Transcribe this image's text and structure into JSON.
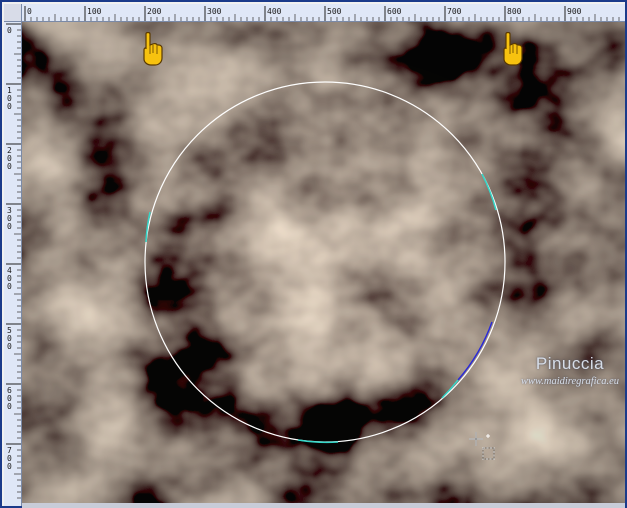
{
  "rulers": {
    "top_labels": [
      "0",
      "100",
      "200",
      "300",
      "400",
      "500",
      "600",
      "700",
      "800",
      "900"
    ],
    "left_labels": [
      "0",
      "100",
      "200",
      "300",
      "400",
      "500",
      "600",
      "700"
    ]
  },
  "canvas": {
    "selection_shape": "circle",
    "texture_colors": [
      "#a28e78",
      "#5c5448",
      "#2a2a33",
      "#b8a088"
    ]
  },
  "icons": [
    "hand-pointer-icon",
    "hand-pointer-icon",
    "move-cursor-icon"
  ],
  "watermark": {
    "name": "Pinuccia",
    "url": "www.maidiregrafica.eu"
  },
  "colors": {
    "frame": "#1a3a8a",
    "ruler_bg": "#dfe7f7",
    "selection_stroke": "#ffffff",
    "pointer_fill": "#f7c20f"
  }
}
